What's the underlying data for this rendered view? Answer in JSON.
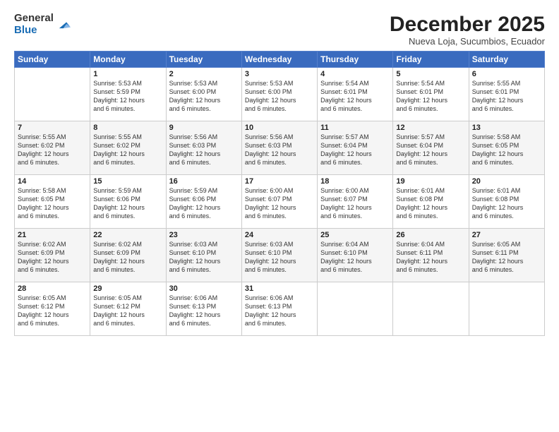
{
  "logo": {
    "general": "General",
    "blue": "Blue"
  },
  "title": "December 2025",
  "location": "Nueva Loja, Sucumbios, Ecuador",
  "days_of_week": [
    "Sunday",
    "Monday",
    "Tuesday",
    "Wednesday",
    "Thursday",
    "Friday",
    "Saturday"
  ],
  "weeks": [
    [
      {
        "day": "",
        "info": ""
      },
      {
        "day": "1",
        "info": "Sunrise: 5:53 AM\nSunset: 5:59 PM\nDaylight: 12 hours\nand 6 minutes."
      },
      {
        "day": "2",
        "info": "Sunrise: 5:53 AM\nSunset: 6:00 PM\nDaylight: 12 hours\nand 6 minutes."
      },
      {
        "day": "3",
        "info": "Sunrise: 5:53 AM\nSunset: 6:00 PM\nDaylight: 12 hours\nand 6 minutes."
      },
      {
        "day": "4",
        "info": "Sunrise: 5:54 AM\nSunset: 6:01 PM\nDaylight: 12 hours\nand 6 minutes."
      },
      {
        "day": "5",
        "info": "Sunrise: 5:54 AM\nSunset: 6:01 PM\nDaylight: 12 hours\nand 6 minutes."
      },
      {
        "day": "6",
        "info": "Sunrise: 5:55 AM\nSunset: 6:01 PM\nDaylight: 12 hours\nand 6 minutes."
      }
    ],
    [
      {
        "day": "7",
        "info": "Sunrise: 5:55 AM\nSunset: 6:02 PM\nDaylight: 12 hours\nand 6 minutes."
      },
      {
        "day": "8",
        "info": "Sunrise: 5:55 AM\nSunset: 6:02 PM\nDaylight: 12 hours\nand 6 minutes."
      },
      {
        "day": "9",
        "info": "Sunrise: 5:56 AM\nSunset: 6:03 PM\nDaylight: 12 hours\nand 6 minutes."
      },
      {
        "day": "10",
        "info": "Sunrise: 5:56 AM\nSunset: 6:03 PM\nDaylight: 12 hours\nand 6 minutes."
      },
      {
        "day": "11",
        "info": "Sunrise: 5:57 AM\nSunset: 6:04 PM\nDaylight: 12 hours\nand 6 minutes."
      },
      {
        "day": "12",
        "info": "Sunrise: 5:57 AM\nSunset: 6:04 PM\nDaylight: 12 hours\nand 6 minutes."
      },
      {
        "day": "13",
        "info": "Sunrise: 5:58 AM\nSunset: 6:05 PM\nDaylight: 12 hours\nand 6 minutes."
      }
    ],
    [
      {
        "day": "14",
        "info": "Sunrise: 5:58 AM\nSunset: 6:05 PM\nDaylight: 12 hours\nand 6 minutes."
      },
      {
        "day": "15",
        "info": "Sunrise: 5:59 AM\nSunset: 6:06 PM\nDaylight: 12 hours\nand 6 minutes."
      },
      {
        "day": "16",
        "info": "Sunrise: 5:59 AM\nSunset: 6:06 PM\nDaylight: 12 hours\nand 6 minutes."
      },
      {
        "day": "17",
        "info": "Sunrise: 6:00 AM\nSunset: 6:07 PM\nDaylight: 12 hours\nand 6 minutes."
      },
      {
        "day": "18",
        "info": "Sunrise: 6:00 AM\nSunset: 6:07 PM\nDaylight: 12 hours\nand 6 minutes."
      },
      {
        "day": "19",
        "info": "Sunrise: 6:01 AM\nSunset: 6:08 PM\nDaylight: 12 hours\nand 6 minutes."
      },
      {
        "day": "20",
        "info": "Sunrise: 6:01 AM\nSunset: 6:08 PM\nDaylight: 12 hours\nand 6 minutes."
      }
    ],
    [
      {
        "day": "21",
        "info": "Sunrise: 6:02 AM\nSunset: 6:09 PM\nDaylight: 12 hours\nand 6 minutes."
      },
      {
        "day": "22",
        "info": "Sunrise: 6:02 AM\nSunset: 6:09 PM\nDaylight: 12 hours\nand 6 minutes."
      },
      {
        "day": "23",
        "info": "Sunrise: 6:03 AM\nSunset: 6:10 PM\nDaylight: 12 hours\nand 6 minutes."
      },
      {
        "day": "24",
        "info": "Sunrise: 6:03 AM\nSunset: 6:10 PM\nDaylight: 12 hours\nand 6 minutes."
      },
      {
        "day": "25",
        "info": "Sunrise: 6:04 AM\nSunset: 6:10 PM\nDaylight: 12 hours\nand 6 minutes."
      },
      {
        "day": "26",
        "info": "Sunrise: 6:04 AM\nSunset: 6:11 PM\nDaylight: 12 hours\nand 6 minutes."
      },
      {
        "day": "27",
        "info": "Sunrise: 6:05 AM\nSunset: 6:11 PM\nDaylight: 12 hours\nand 6 minutes."
      }
    ],
    [
      {
        "day": "28",
        "info": "Sunrise: 6:05 AM\nSunset: 6:12 PM\nDaylight: 12 hours\nand 6 minutes."
      },
      {
        "day": "29",
        "info": "Sunrise: 6:05 AM\nSunset: 6:12 PM\nDaylight: 12 hours\nand 6 minutes."
      },
      {
        "day": "30",
        "info": "Sunrise: 6:06 AM\nSunset: 6:13 PM\nDaylight: 12 hours\nand 6 minutes."
      },
      {
        "day": "31",
        "info": "Sunrise: 6:06 AM\nSunset: 6:13 PM\nDaylight: 12 hours\nand 6 minutes."
      },
      {
        "day": "",
        "info": ""
      },
      {
        "day": "",
        "info": ""
      },
      {
        "day": "",
        "info": ""
      }
    ]
  ]
}
